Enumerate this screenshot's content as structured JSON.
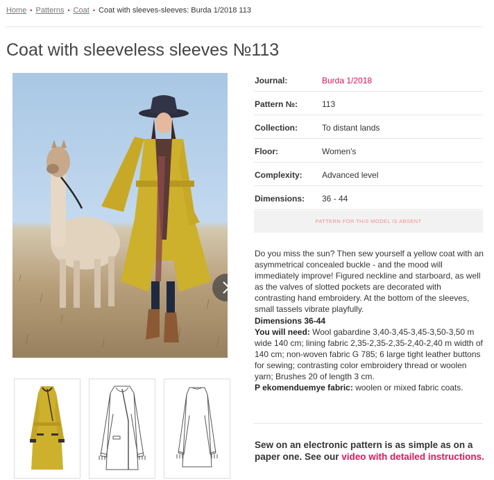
{
  "breadcrumb": {
    "home": "Home",
    "patterns": "Patterns",
    "coat": "Coat",
    "current": "Coat with sleeves-sleeves: Burda 1/2018 113",
    "separator": "•"
  },
  "title": "Coat with sleeveless sleeves №113",
  "gallery": {
    "main_image": "model-in-yellow-coat-with-alpaca-photo",
    "next_icon": "chevron-right-icon",
    "thumbnails": [
      "front-photo-thumbnail",
      "front-technical-drawing-thumbnail",
      "back-technical-drawing-thumbnail"
    ]
  },
  "specs": [
    {
      "label": "Journal:",
      "value": "Burda 1/2018"
    },
    {
      "label": "Pattern №:",
      "value": "113"
    },
    {
      "label": "Collection:",
      "value": "To distant lands"
    },
    {
      "label": "Floor:",
      "value": "Women's"
    },
    {
      "label": "Complexity:",
      "value": "Advanced level"
    },
    {
      "label": "Dimensions:",
      "value": "36 - 44"
    }
  ],
  "absent_notice": "PATTERN FOR THIS MODEL IS ABSENT",
  "description": {
    "intro": "Do you miss the sun? Then sew yourself a yellow coat with an asymmetrical concealed buckle - and the mood will immediately improve! Figured neckline and starboard, as well as the valves of slotted pockets are decorated with contrasting hand embroidery. At the bottom of the sleeves, small tassels vibrate playfully.",
    "dimensions": "Dimensions 36-44",
    "need_label": "You will need:",
    "need_text": "Wool gabardine 3,40-3,45-3,45-3,50-3,50 m wide 140 cm; lining fabric 2,35-2,35-2,35-2,40-2,40 m width of 140 cm; non-woven fabric G 785; 6 large tight leather buttons for sewing; contrasting color embroidery thread or woolen yarn; Brushes 20 of length 3 cm.",
    "fabric_label": "P ekomenduemye fabric:",
    "fabric_text": "woolen or mixed fabric coats."
  },
  "cta": {
    "text": "Sew on an electronic pattern is as simple as on a paper one. See our ",
    "link": "video with detailed instructions."
  },
  "colors": {
    "accent": "#e0175a",
    "coat_yellow": "#cdb02c"
  }
}
